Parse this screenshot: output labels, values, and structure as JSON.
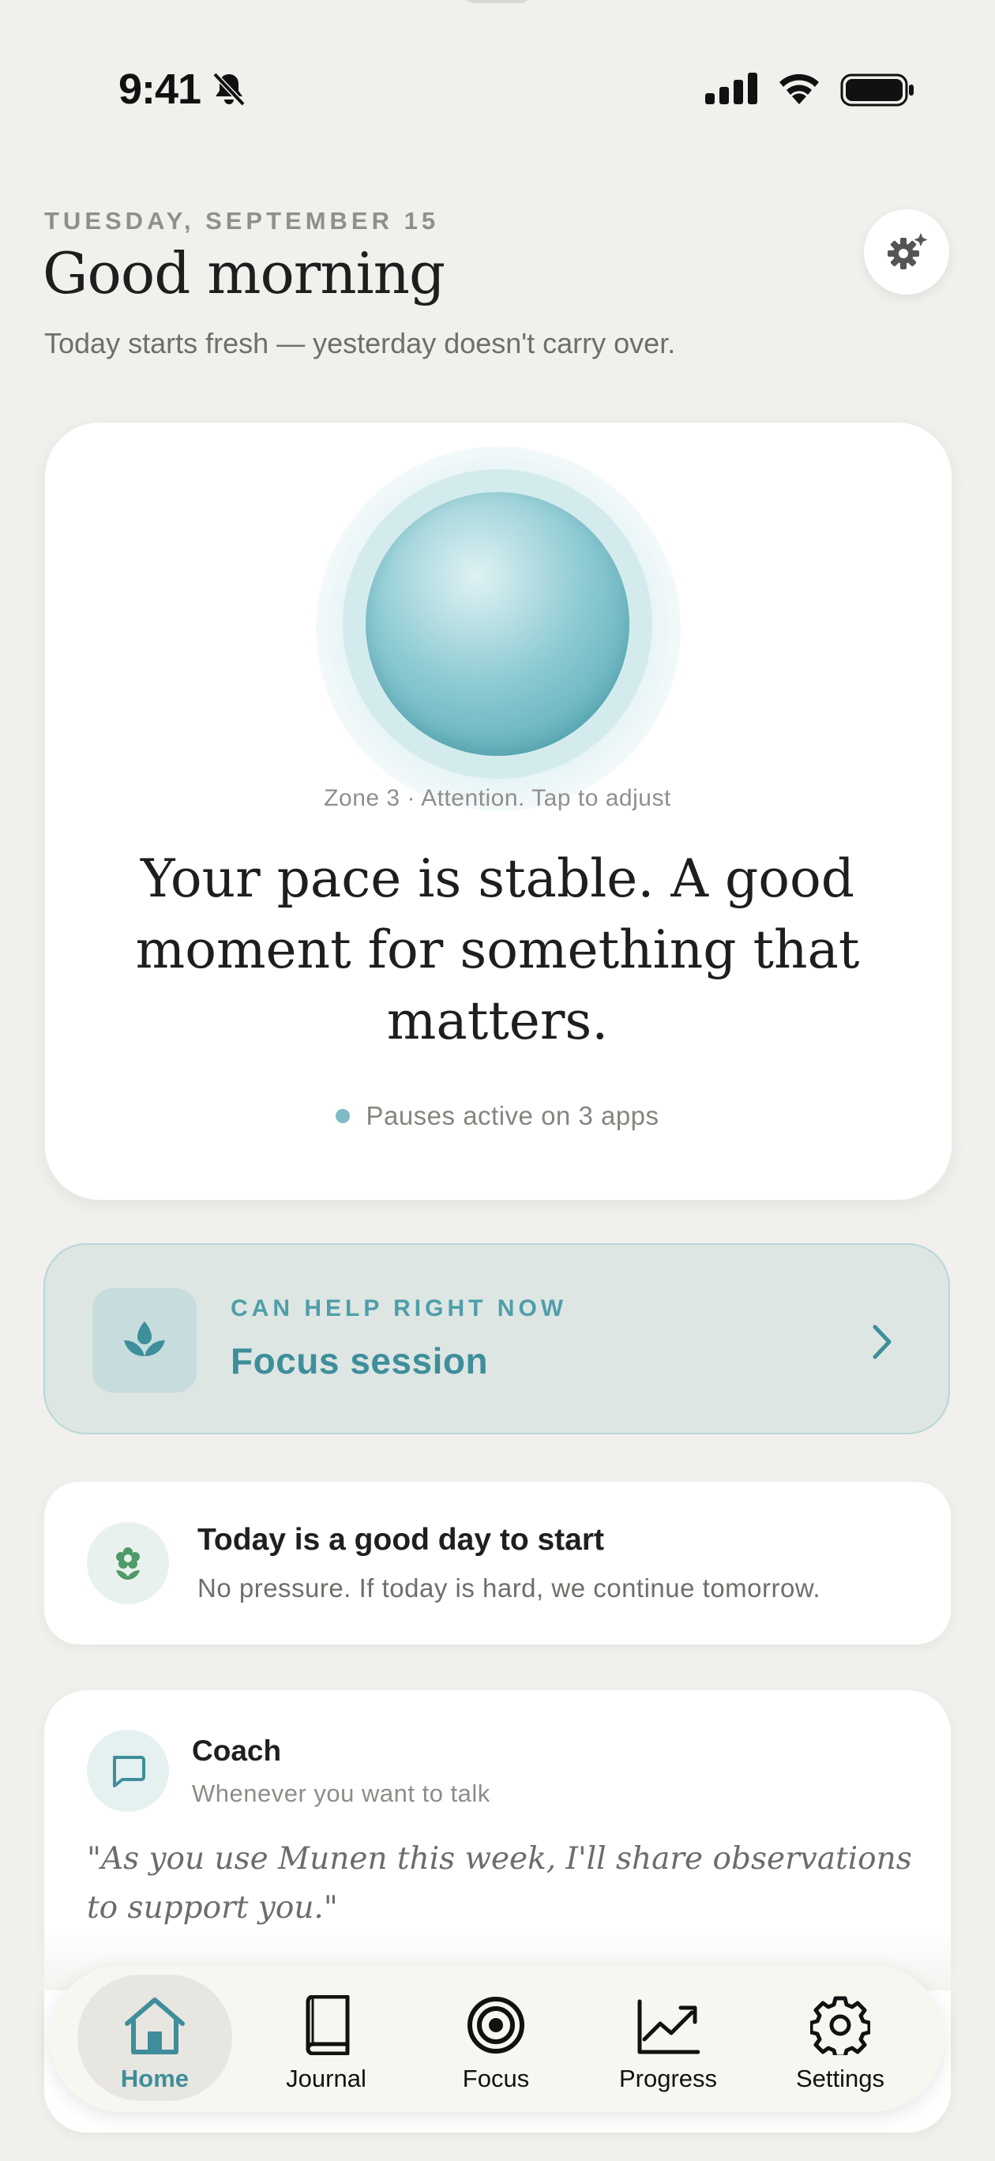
{
  "status_bar": {
    "time": "9:41"
  },
  "header": {
    "date": "TUESDAY, SEPTEMBER 15",
    "greeting": "Good morning",
    "subtitle": "Today starts fresh — yesterday doesn't carry over."
  },
  "state_card": {
    "zone_label": "Zone 3 · Attention. Tap to adjust",
    "headline": "Your pace is stable. A good moment for something that matters.",
    "pauses": "Pauses active on 3 apps"
  },
  "focus_card": {
    "kicker": "CAN HELP RIGHT NOW",
    "title": "Focus session"
  },
  "start_card": {
    "title": "Today is a good day to start",
    "subtitle": "No pressure. If today is hard, we continue tomorrow."
  },
  "coach_card": {
    "title": "Coach",
    "subtitle": "Whenever you want to talk",
    "quote": "\"As you use Munen this week, I'll share observations to support you.\""
  },
  "tabs": [
    {
      "label": "Home",
      "icon": "home-icon",
      "active": true
    },
    {
      "label": "Journal",
      "icon": "book-icon",
      "active": false
    },
    {
      "label": "Focus",
      "icon": "target-icon",
      "active": false
    },
    {
      "label": "Progress",
      "icon": "chart-icon",
      "active": false
    },
    {
      "label": "Settings",
      "icon": "gear-icon",
      "active": false
    }
  ],
  "colors": {
    "background": "#F1F0EC",
    "accent": "#3E8E9B",
    "focus_card_bg": "#DDE6E3",
    "orb": "#68B4BF",
    "growth_green": "#4E9A6A"
  }
}
